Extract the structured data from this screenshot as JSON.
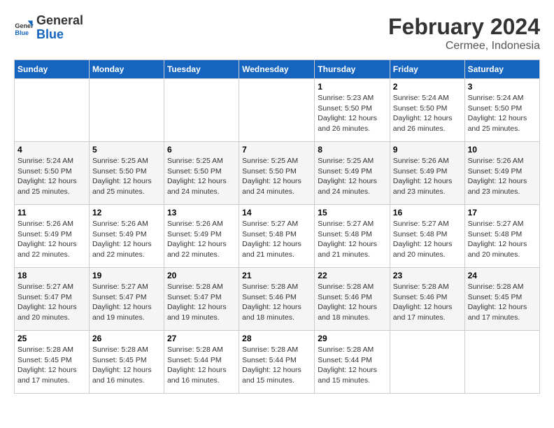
{
  "header": {
    "logo_line1": "General",
    "logo_line2": "Blue",
    "title": "February 2024",
    "subtitle": "Cermee, Indonesia"
  },
  "weekdays": [
    "Sunday",
    "Monday",
    "Tuesday",
    "Wednesday",
    "Thursday",
    "Friday",
    "Saturday"
  ],
  "weeks": [
    [
      {
        "day": "",
        "info": ""
      },
      {
        "day": "",
        "info": ""
      },
      {
        "day": "",
        "info": ""
      },
      {
        "day": "",
        "info": ""
      },
      {
        "day": "1",
        "info": "Sunrise: 5:23 AM\nSunset: 5:50 PM\nDaylight: 12 hours and 26 minutes."
      },
      {
        "day": "2",
        "info": "Sunrise: 5:24 AM\nSunset: 5:50 PM\nDaylight: 12 hours and 26 minutes."
      },
      {
        "day": "3",
        "info": "Sunrise: 5:24 AM\nSunset: 5:50 PM\nDaylight: 12 hours and 25 minutes."
      }
    ],
    [
      {
        "day": "4",
        "info": "Sunrise: 5:24 AM\nSunset: 5:50 PM\nDaylight: 12 hours and 25 minutes."
      },
      {
        "day": "5",
        "info": "Sunrise: 5:25 AM\nSunset: 5:50 PM\nDaylight: 12 hours and 25 minutes."
      },
      {
        "day": "6",
        "info": "Sunrise: 5:25 AM\nSunset: 5:50 PM\nDaylight: 12 hours and 24 minutes."
      },
      {
        "day": "7",
        "info": "Sunrise: 5:25 AM\nSunset: 5:50 PM\nDaylight: 12 hours and 24 minutes."
      },
      {
        "day": "8",
        "info": "Sunrise: 5:25 AM\nSunset: 5:49 PM\nDaylight: 12 hours and 24 minutes."
      },
      {
        "day": "9",
        "info": "Sunrise: 5:26 AM\nSunset: 5:49 PM\nDaylight: 12 hours and 23 minutes."
      },
      {
        "day": "10",
        "info": "Sunrise: 5:26 AM\nSunset: 5:49 PM\nDaylight: 12 hours and 23 minutes."
      }
    ],
    [
      {
        "day": "11",
        "info": "Sunrise: 5:26 AM\nSunset: 5:49 PM\nDaylight: 12 hours and 22 minutes."
      },
      {
        "day": "12",
        "info": "Sunrise: 5:26 AM\nSunset: 5:49 PM\nDaylight: 12 hours and 22 minutes."
      },
      {
        "day": "13",
        "info": "Sunrise: 5:26 AM\nSunset: 5:49 PM\nDaylight: 12 hours and 22 minutes."
      },
      {
        "day": "14",
        "info": "Sunrise: 5:27 AM\nSunset: 5:48 PM\nDaylight: 12 hours and 21 minutes."
      },
      {
        "day": "15",
        "info": "Sunrise: 5:27 AM\nSunset: 5:48 PM\nDaylight: 12 hours and 21 minutes."
      },
      {
        "day": "16",
        "info": "Sunrise: 5:27 AM\nSunset: 5:48 PM\nDaylight: 12 hours and 20 minutes."
      },
      {
        "day": "17",
        "info": "Sunrise: 5:27 AM\nSunset: 5:48 PM\nDaylight: 12 hours and 20 minutes."
      }
    ],
    [
      {
        "day": "18",
        "info": "Sunrise: 5:27 AM\nSunset: 5:47 PM\nDaylight: 12 hours and 20 minutes."
      },
      {
        "day": "19",
        "info": "Sunrise: 5:27 AM\nSunset: 5:47 PM\nDaylight: 12 hours and 19 minutes."
      },
      {
        "day": "20",
        "info": "Sunrise: 5:28 AM\nSunset: 5:47 PM\nDaylight: 12 hours and 19 minutes."
      },
      {
        "day": "21",
        "info": "Sunrise: 5:28 AM\nSunset: 5:46 PM\nDaylight: 12 hours and 18 minutes."
      },
      {
        "day": "22",
        "info": "Sunrise: 5:28 AM\nSunset: 5:46 PM\nDaylight: 12 hours and 18 minutes."
      },
      {
        "day": "23",
        "info": "Sunrise: 5:28 AM\nSunset: 5:46 PM\nDaylight: 12 hours and 17 minutes."
      },
      {
        "day": "24",
        "info": "Sunrise: 5:28 AM\nSunset: 5:45 PM\nDaylight: 12 hours and 17 minutes."
      }
    ],
    [
      {
        "day": "25",
        "info": "Sunrise: 5:28 AM\nSunset: 5:45 PM\nDaylight: 12 hours and 17 minutes."
      },
      {
        "day": "26",
        "info": "Sunrise: 5:28 AM\nSunset: 5:45 PM\nDaylight: 12 hours and 16 minutes."
      },
      {
        "day": "27",
        "info": "Sunrise: 5:28 AM\nSunset: 5:44 PM\nDaylight: 12 hours and 16 minutes."
      },
      {
        "day": "28",
        "info": "Sunrise: 5:28 AM\nSunset: 5:44 PM\nDaylight: 12 hours and 15 minutes."
      },
      {
        "day": "29",
        "info": "Sunrise: 5:28 AM\nSunset: 5:44 PM\nDaylight: 12 hours and 15 minutes."
      },
      {
        "day": "",
        "info": ""
      },
      {
        "day": "",
        "info": ""
      }
    ]
  ]
}
